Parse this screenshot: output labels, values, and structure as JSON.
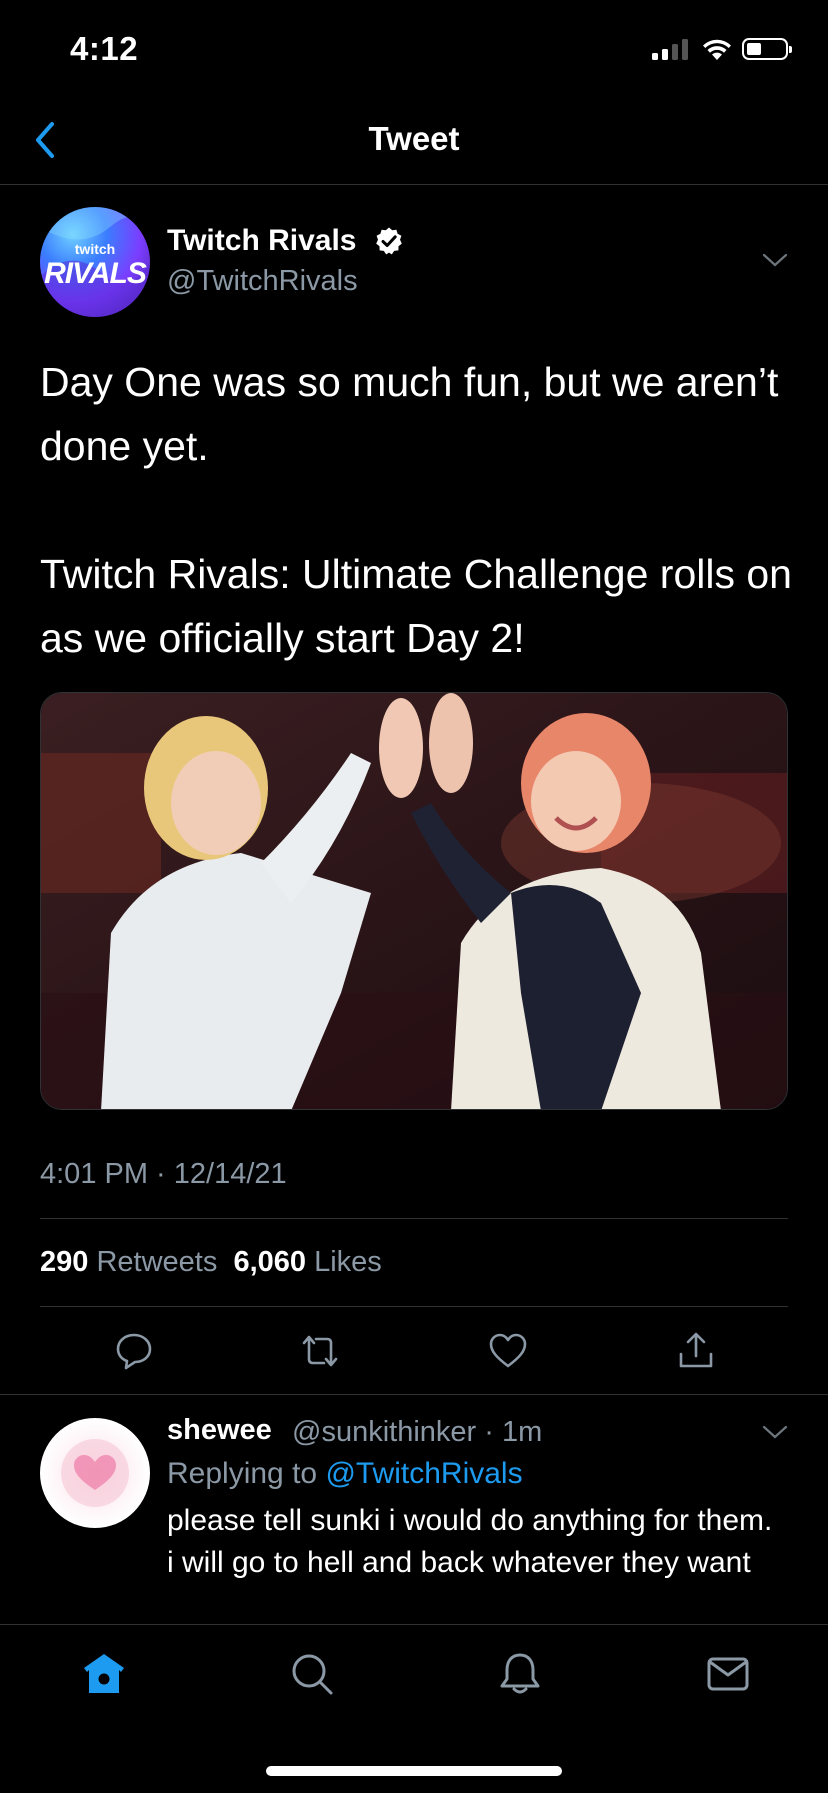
{
  "status_bar": {
    "time": "4:12"
  },
  "nav": {
    "title": "Tweet"
  },
  "tweet": {
    "author": {
      "name": "Twitch Rivals",
      "handle": "@TwitchRivals",
      "avatar_text_top": "twitch",
      "avatar_text_bottom": "RIVALS"
    },
    "paragraphs": [
      "Day One was so much fun, but we aren’t done yet.",
      "Twitch Rivals: Ultimate Challenge rolls on as we officially start Day 2!"
    ],
    "timestamp": "4:01 PM · 12/14/21",
    "stats": {
      "retweets_count": "290",
      "retweets_label": "Retweets",
      "likes_count": "6,060",
      "likes_label": "Likes"
    }
  },
  "reply": {
    "name": "shewee",
    "handle_time": "@sunkithinker · 1m",
    "replying_prefix": "Replying to",
    "replying_mention": "@TwitchRivals",
    "text": "please tell sunki i would do anything for them. i will go to hell and back whatever they want"
  },
  "colors": {
    "accent": "#1d9bf0",
    "muted": "#8b98a5",
    "divider": "#2f3336",
    "background": "#000000"
  },
  "icons": {
    "actions": [
      "reply-icon",
      "retweet-icon",
      "like-icon",
      "share-icon"
    ],
    "tabs": [
      "home-icon",
      "search-icon",
      "notifications-icon",
      "messages-icon"
    ]
  }
}
